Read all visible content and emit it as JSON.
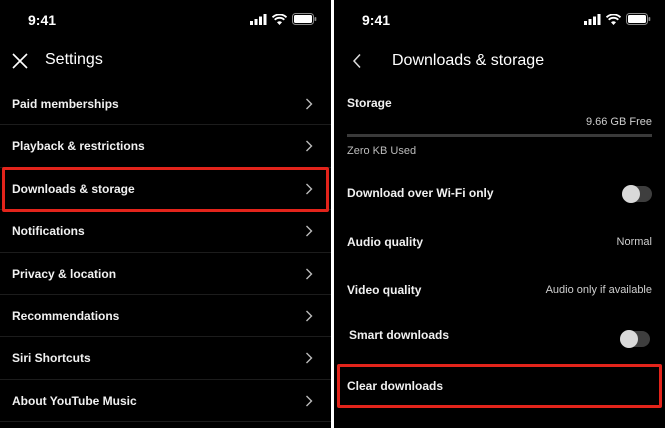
{
  "left": {
    "status_time": "9:41",
    "title": "Settings",
    "items": [
      "Paid memberships",
      "Playback & restrictions",
      "Downloads & storage",
      "Notifications",
      "Privacy & location",
      "Recommendations",
      "Siri Shortcuts",
      "About YouTube Music"
    ],
    "highlighted_item": "Downloads & storage"
  },
  "right": {
    "status_time": "9:41",
    "title": "Downloads & storage",
    "storage": {
      "label": "Storage",
      "free": "9.66 GB Free",
      "used": "Zero KB Used"
    },
    "wifi_only": {
      "label": "Download over Wi-Fi only",
      "enabled": false
    },
    "audio_quality": {
      "label": "Audio quality",
      "value": "Normal"
    },
    "video_quality": {
      "label": "Video quality",
      "value": "Audio only if available"
    },
    "smart_downloads": {
      "label": "Smart downloads",
      "enabled": false
    },
    "clear_downloads": {
      "label": "Clear downloads"
    }
  },
  "colors": {
    "background": "#000000",
    "highlight": "#e3241b",
    "text": "#f1f1f1",
    "secondary_text": "#cfcfcf"
  }
}
